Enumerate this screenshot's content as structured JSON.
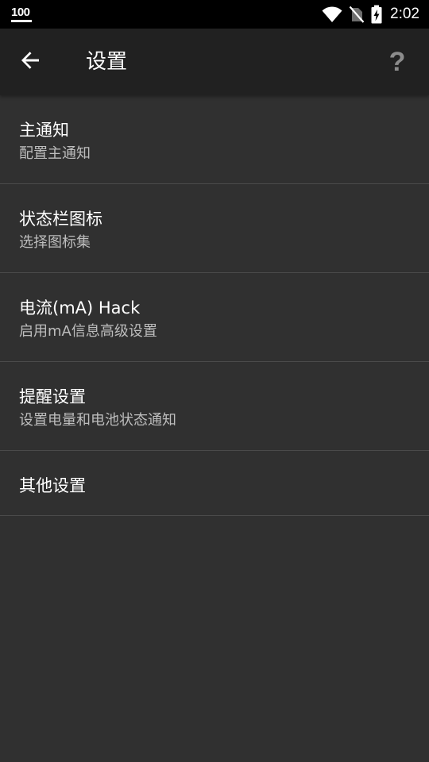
{
  "status_bar": {
    "notification_number": "100",
    "time": "2:02",
    "icons": [
      "wifi-icon",
      "no-sim-icon",
      "battery-charging-icon"
    ]
  },
  "app_bar": {
    "back_icon": "arrow-back-icon",
    "title": "设置",
    "help_label": "?"
  },
  "settings": {
    "items": [
      {
        "title": "主通知",
        "subtitle": "配置主通知"
      },
      {
        "title": "状态栏图标",
        "subtitle": "选择图标集"
      },
      {
        "title": "电流(mA) Hack",
        "subtitle": "启用mA信息高级设置"
      },
      {
        "title": "提醒设置",
        "subtitle": "设置电量和电池状态通知"
      },
      {
        "title": "其他设置"
      }
    ]
  },
  "colors": {
    "background": "#303030",
    "app_bar": "#212121",
    "status_bar": "#000000",
    "title_text": "#ffffff",
    "subtitle_text": "#bdbdbd",
    "divider": "#4a4a4a"
  }
}
